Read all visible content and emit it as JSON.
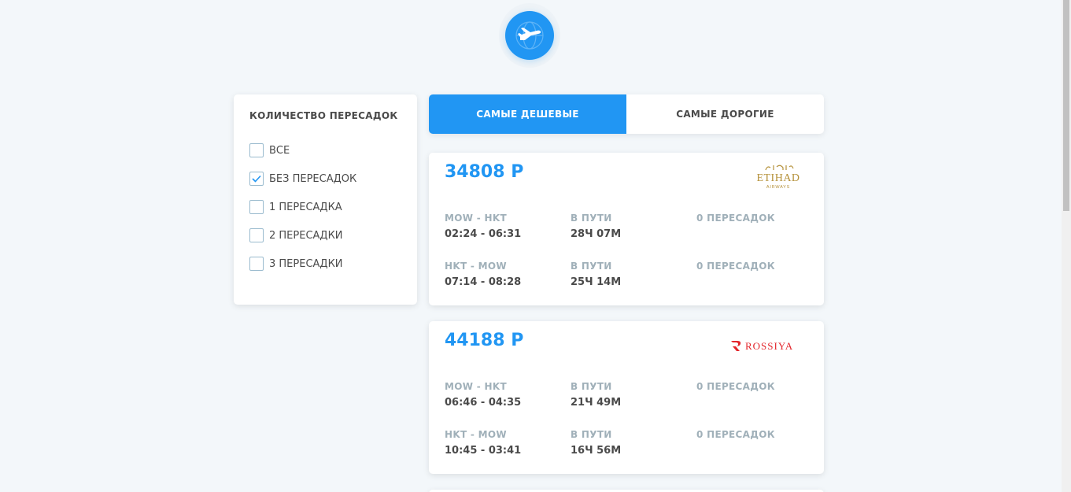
{
  "filter": {
    "title": "КОЛИЧЕСТВО ПЕРЕСАДОК",
    "options": [
      {
        "label": "ВСЕ",
        "checked": false
      },
      {
        "label": "БЕЗ ПЕРЕСАДОК",
        "checked": true
      },
      {
        "label": "1 ПЕРЕСАДКА",
        "checked": false
      },
      {
        "label": "2 ПЕРЕСАДКИ",
        "checked": false
      },
      {
        "label": "3 ПЕРЕСАДКИ",
        "checked": false
      }
    ]
  },
  "tabs": [
    {
      "label": "САМЫЕ ДЕШЕВЫЕ",
      "active": true
    },
    {
      "label": "САМЫЕ ДОРОГИЕ",
      "active": false
    }
  ],
  "tickets": [
    {
      "price": "34808 Р",
      "carrier": "ETIHAD AIRWAYS",
      "segments": [
        {
          "route": "MOW - HKT",
          "time": "02:24 - 06:31",
          "duration_label": "В ПУТИ",
          "duration": "28Ч 07М",
          "stops": "0 ПЕРЕСАДОК"
        },
        {
          "route": "HKT - MOW",
          "time": "07:14 - 08:28",
          "duration_label": "В ПУТИ",
          "duration": "25Ч 14М",
          "stops": "0 ПЕРЕСАДОК"
        }
      ]
    },
    {
      "price": "44188 Р",
      "carrier": "ROSSIYA",
      "segments": [
        {
          "route": "MOW - HKT",
          "time": "06:46 - 04:35",
          "duration_label": "В ПУТИ",
          "duration": "21Ч 49М",
          "stops": "0 ПЕРЕСАДОК"
        },
        {
          "route": "HKT - MOW",
          "time": "10:45 - 03:41",
          "duration_label": "В ПУТИ",
          "duration": "16Ч 56М",
          "stops": "0 ПЕРЕСАДОК"
        }
      ]
    }
  ],
  "colors": {
    "accent": "#2196f3",
    "muted": "#a0b0b9",
    "etihad": "#b5913a",
    "rossiya": "#e3262c"
  }
}
